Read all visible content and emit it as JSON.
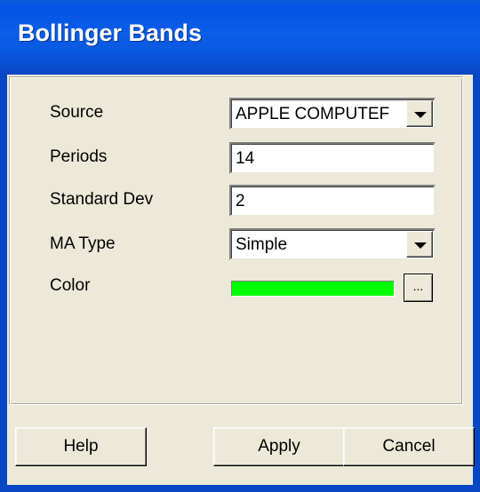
{
  "window": {
    "title": "Bollinger Bands"
  },
  "form": {
    "source": {
      "label": "Source",
      "value": "APPLE COMPUTEF"
    },
    "periods": {
      "label": "Periods",
      "value": "14"
    },
    "std_dev": {
      "label": "Standard Dev",
      "value": "2"
    },
    "ma_type": {
      "label": "MA Type",
      "value": "Simple"
    },
    "color": {
      "label": "Color",
      "value_color": "#00ff00",
      "picker_label": "..."
    }
  },
  "buttons": {
    "help": "Help",
    "apply": "Apply",
    "cancel": "Cancel"
  },
  "icons": {
    "dropdown": "chevron-down-icon"
  }
}
